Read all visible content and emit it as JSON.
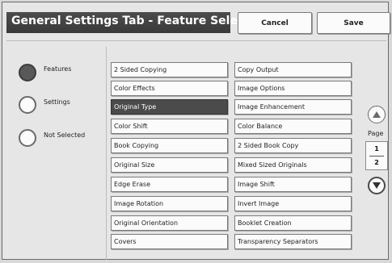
{
  "header": {
    "title": "General Settings Tab - Feature Selection",
    "cancel_label": "Cancel",
    "save_label": "Save"
  },
  "filter": {
    "options": [
      {
        "label": "Features",
        "selected": true
      },
      {
        "label": "Settings",
        "selected": false
      },
      {
        "label": "Not Selected",
        "selected": false
      }
    ]
  },
  "features": {
    "left": [
      "2 Sided Copying",
      "Color Effects",
      "Original Type",
      "Color Shift",
      "Book Copying",
      "Original Size",
      "Edge Erase",
      "Image Rotation",
      "Original Orientation",
      "Covers"
    ],
    "right": [
      "Copy Output",
      "Image Options",
      "Image Enhancement",
      "Color Balance",
      "2 Sided Book Copy",
      "Mixed Sized Originals",
      "Image Shift",
      "Invert Image",
      "Booklet Creation",
      "Transparency Separators"
    ],
    "selected": "Original Type"
  },
  "pager": {
    "label": "Page",
    "current": "1",
    "total": "2",
    "up_icon": "triangle-up-icon",
    "down_icon": "triangle-down-icon"
  }
}
